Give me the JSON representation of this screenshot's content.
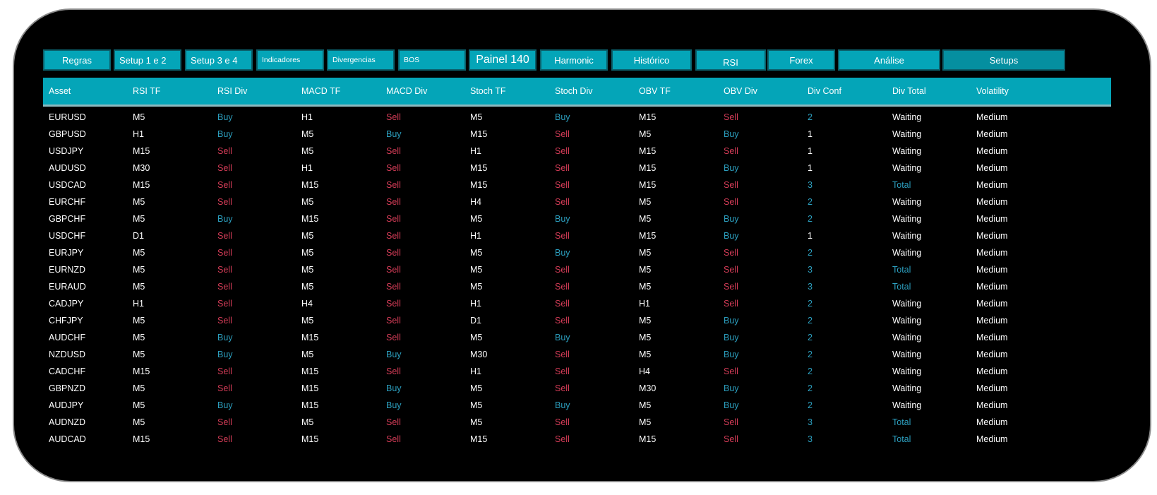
{
  "colors": {
    "background": "#000000",
    "frame_border": "#8a8a8a",
    "tab_bg": "#04a5b8",
    "header_bg": "#04a5b8",
    "buy": "#2c9fbf",
    "sell": "#d43c57",
    "text": "#ffffff"
  },
  "tabs": [
    {
      "label": "Regras"
    },
    {
      "label": "Setup 1 e 2"
    },
    {
      "label": "Setup 3 e 4"
    },
    {
      "label": "Indicadores"
    },
    {
      "label": "Divergencias"
    },
    {
      "label": "BOS"
    },
    {
      "label": "Painel 140"
    },
    {
      "label": "Harmonic"
    },
    {
      "label": "Histórico"
    },
    {
      "label": "RSI"
    },
    {
      "label": "Forex"
    },
    {
      "label": "Análise"
    },
    {
      "label": "Setups"
    }
  ],
  "table": {
    "columns": [
      "Asset",
      "RSI TF",
      "RSI Div",
      "MACD TF",
      "MACD Div",
      "Stoch TF",
      "Stoch Div",
      "OBV TF",
      "OBV Div",
      "Div Conf",
      "Div Total",
      "Volatility"
    ],
    "rows": [
      [
        "EURUSD",
        "M5",
        "Buy",
        "H1",
        "Sell",
        "M5",
        "Buy",
        "M15",
        "Sell",
        "2",
        "Waiting",
        "Medium"
      ],
      [
        "GBPUSD",
        "H1",
        "Buy",
        "M5",
        "Buy",
        "M15",
        "Sell",
        "M5",
        "Buy",
        "1",
        "Waiting",
        "Medium"
      ],
      [
        "USDJPY",
        "M15",
        "Sell",
        "M5",
        "Sell",
        "H1",
        "Sell",
        "M15",
        "Sell",
        "1",
        "Waiting",
        "Medium"
      ],
      [
        "AUDUSD",
        "M30",
        "Sell",
        "H1",
        "Sell",
        "M15",
        "Sell",
        "M15",
        "Buy",
        "1",
        "Waiting",
        "Medium"
      ],
      [
        "USDCAD",
        "M15",
        "Sell",
        "M15",
        "Sell",
        "M15",
        "Sell",
        "M15",
        "Sell",
        "3",
        "Total",
        "Medium"
      ],
      [
        "EURCHF",
        "M5",
        "Sell",
        "M5",
        "Sell",
        "H4",
        "Sell",
        "M5",
        "Sell",
        "2",
        "Waiting",
        "Medium"
      ],
      [
        "GBPCHF",
        "M5",
        "Buy",
        "M15",
        "Sell",
        "M5",
        "Buy",
        "M5",
        "Buy",
        "2",
        "Waiting",
        "Medium"
      ],
      [
        "USDCHF",
        "D1",
        "Sell",
        "M5",
        "Sell",
        "H1",
        "Sell",
        "M15",
        "Buy",
        "1",
        "Waiting",
        "Medium"
      ],
      [
        "EURJPY",
        "M5",
        "Sell",
        "M5",
        "Sell",
        "M5",
        "Buy",
        "M5",
        "Sell",
        "2",
        "Waiting",
        "Medium"
      ],
      [
        "EURNZD",
        "M5",
        "Sell",
        "M5",
        "Sell",
        "M5",
        "Sell",
        "M5",
        "Sell",
        "3",
        "Total",
        "Medium"
      ],
      [
        "EURAUD",
        "M5",
        "Sell",
        "M5",
        "Sell",
        "M5",
        "Sell",
        "M5",
        "Sell",
        "3",
        "Total",
        "Medium"
      ],
      [
        "CADJPY",
        "H1",
        "Sell",
        "H4",
        "Sell",
        "H1",
        "Sell",
        "H1",
        "Sell",
        "2",
        "Waiting",
        "Medium"
      ],
      [
        "CHFJPY",
        "M5",
        "Sell",
        "M5",
        "Sell",
        "D1",
        "Sell",
        "M5",
        "Buy",
        "2",
        "Waiting",
        "Medium"
      ],
      [
        "AUDCHF",
        "M5",
        "Buy",
        "M15",
        "Sell",
        "M5",
        "Buy",
        "M5",
        "Buy",
        "2",
        "Waiting",
        "Medium"
      ],
      [
        "NZDUSD",
        "M5",
        "Buy",
        "M5",
        "Buy",
        "M30",
        "Sell",
        "M5",
        "Buy",
        "2",
        "Waiting",
        "Medium"
      ],
      [
        "CADCHF",
        "M15",
        "Sell",
        "M15",
        "Sell",
        "H1",
        "Sell",
        "H4",
        "Sell",
        "2",
        "Waiting",
        "Medium"
      ],
      [
        "GBPNZD",
        "M5",
        "Sell",
        "M15",
        "Buy",
        "M5",
        "Sell",
        "M30",
        "Buy",
        "2",
        "Waiting",
        "Medium"
      ],
      [
        "AUDJPY",
        "M5",
        "Buy",
        "M15",
        "Buy",
        "M5",
        "Buy",
        "M5",
        "Buy",
        "2",
        "Waiting",
        "Medium"
      ],
      [
        "AUDNZD",
        "M5",
        "Sell",
        "M5",
        "Sell",
        "M5",
        "Sell",
        "M5",
        "Sell",
        "3",
        "Total",
        "Medium"
      ],
      [
        "AUDCAD",
        "M15",
        "Sell",
        "M15",
        "Sell",
        "M15",
        "Sell",
        "M15",
        "Sell",
        "3",
        "Total",
        "Medium"
      ]
    ]
  }
}
